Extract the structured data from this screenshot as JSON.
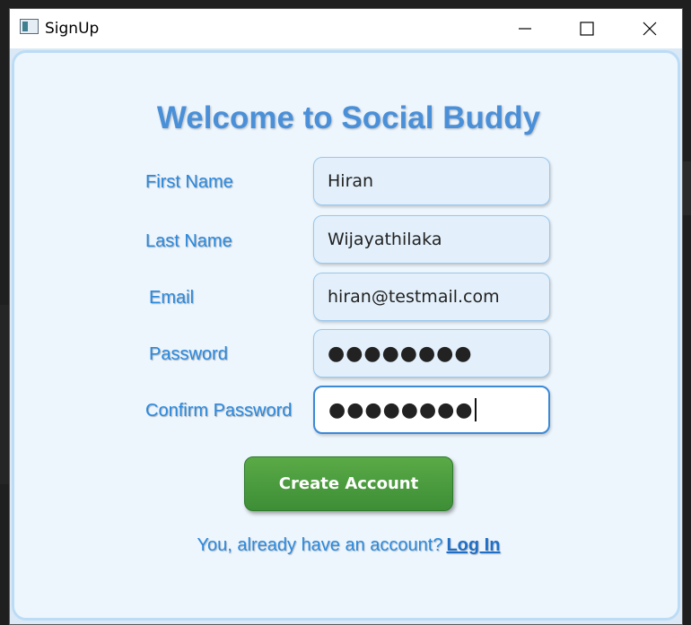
{
  "window": {
    "title": "SignUp"
  },
  "form": {
    "heading": "Welcome to Social Buddy",
    "fields": [
      {
        "label": "First Name",
        "value": "Hiran"
      },
      {
        "label": "Last Name",
        "value": "Wijayathilaka"
      },
      {
        "label": "Email",
        "value": "hiran@testmail.com"
      },
      {
        "label": "Password",
        "value": "●●●●●●●●"
      },
      {
        "label": "Confirm Password",
        "value": "●●●●●●●●"
      }
    ],
    "create_button": "Create Account",
    "footer_text": "You, already have an account?",
    "login_link": "Log In"
  },
  "colors": {
    "accent": "#4a90d9",
    "label": "#2a8adf",
    "button": "#3d8e36"
  },
  "icons": {
    "app": "app-window-icon",
    "minimize": "minimize-icon",
    "maximize": "maximize-icon",
    "close": "close-icon"
  }
}
